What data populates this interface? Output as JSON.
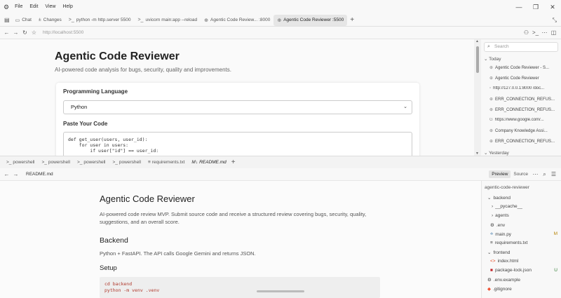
{
  "menubar": {
    "items": [
      "File",
      "Edit",
      "View",
      "Help"
    ]
  },
  "tabs": [
    {
      "label": "Chat",
      "icon": "chat-icon"
    },
    {
      "label": "Changes",
      "icon": "plus-minus-icon"
    },
    {
      "label": "python -m http.server 5500",
      "icon": "terminal-icon"
    },
    {
      "label": "uvicorn main:app --reload",
      "icon": "terminal-icon"
    },
    {
      "label": "Agentic Code Review... :8000",
      "icon": "globe-icon"
    },
    {
      "label": "Agentic Code Reviewer :5500",
      "icon": "globe-icon"
    }
  ],
  "address": {
    "url": "http://localhost:5500"
  },
  "page": {
    "title": "Agentic Code Reviewer",
    "subtitle": "AI-powered code analysis for bugs, security, quality and improvements.",
    "language_label": "Programming Language",
    "language_value": "Python",
    "code_label": "Paste Your Code",
    "code_value": "def get_user(users, user_id):\n    for user in users:\n        if user[\"id\"] == user_id:"
  },
  "history": {
    "search_placeholder": "Search",
    "today_label": "Today",
    "yesterday_label": "Yesterday",
    "items": [
      "Agentic Code Reviewer - S...",
      "Agentic Code Reviewer",
      "http://127.0.0.1:8000 /doc...",
      "ERR_CONNECTION_REFUS...",
      "ERR_CONNECTION_REFUS...",
      "https://www.google.com/...",
      "Company Knowledge Assi...",
      "ERR_CONNECTION_REFUS..."
    ]
  },
  "terminal_tabs": [
    "powershell",
    "powershell",
    "powershell",
    "powershell",
    "requirements.txt",
    "README.md"
  ],
  "md_header": {
    "filename": "README.md",
    "preview": "Preview",
    "source": "Source"
  },
  "markdown": {
    "h1": "Agentic Code Reviewer",
    "p1": "AI-powered code review MVP. Submit source code and receive a structured review covering bugs, security, quality, suggestions, and an overall score.",
    "h2_backend": "Backend",
    "p_backend": "Python + FastAPI. The API calls Google Gemini and returns JSON.",
    "h2_setup": "Setup",
    "code": "cd backend\npython -m venv .venv"
  },
  "explorer": {
    "root": "agentic-code-reviewer",
    "items": [
      {
        "label": "backend",
        "marker": "v"
      },
      {
        "label": "__pycache__",
        "marker": ">"
      },
      {
        "label": "agents",
        "marker": ">"
      },
      {
        "label": ".env",
        "marker": "gear"
      },
      {
        "label": "main.py",
        "marker": "py",
        "badge": "M"
      },
      {
        "label": "requirements.txt",
        "marker": "lines"
      },
      {
        "label": "frontend",
        "marker": "v"
      },
      {
        "label": "index.html",
        "marker": "code"
      },
      {
        "label": "package-lock.json",
        "marker": "npm",
        "badge": "U"
      },
      {
        "label": ".env.example",
        "marker": "gear"
      },
      {
        "label": ".gitignore",
        "marker": "git"
      }
    ]
  },
  "colors": {
    "modified_badge": "#b8860b",
    "untracked_badge": "#2f7d32",
    "code_text": "#b03a2e"
  }
}
